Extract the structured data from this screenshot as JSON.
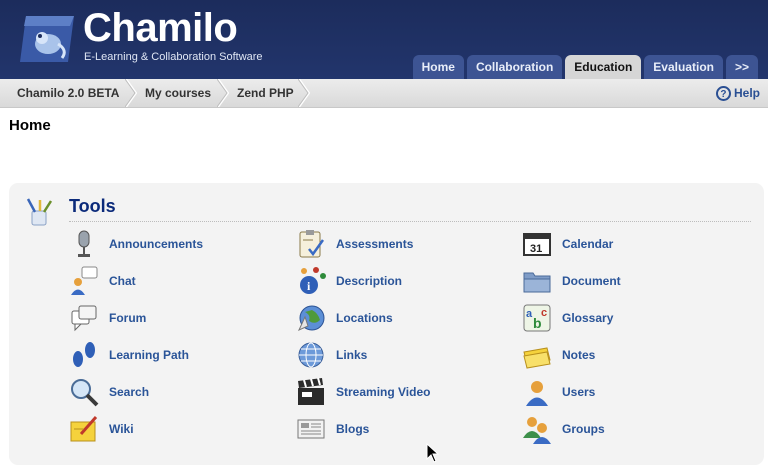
{
  "header": {
    "logo_title": "Chamilo",
    "logo_subtitle": "E-Learning & Collaboration Software",
    "tabs": [
      {
        "label": "Home"
      },
      {
        "label": "Collaboration"
      },
      {
        "label": "Education",
        "active": true
      },
      {
        "label": "Evaluation"
      },
      {
        "label": ">>"
      }
    ]
  },
  "breadcrumb": {
    "items": [
      {
        "label": "Chamilo 2.0 BETA"
      },
      {
        "label": "My courses"
      },
      {
        "label": "Zend PHP"
      }
    ],
    "help_label": "Help"
  },
  "page": {
    "title": "Home"
  },
  "tools": {
    "title": "Tools",
    "columns": [
      [
        {
          "label": "Announcements",
          "icon": "microphone-icon"
        },
        {
          "label": "Chat",
          "icon": "chat-icon"
        },
        {
          "label": "Forum",
          "icon": "forum-icon"
        },
        {
          "label": "Learning Path",
          "icon": "footprints-icon"
        },
        {
          "label": "Search",
          "icon": "magnifier-icon"
        },
        {
          "label": "Wiki",
          "icon": "wiki-icon"
        }
      ],
      [
        {
          "label": "Assessments",
          "icon": "clipboard-icon"
        },
        {
          "label": "Description",
          "icon": "info-icon"
        },
        {
          "label": "Locations",
          "icon": "globe-location-icon"
        },
        {
          "label": "Links",
          "icon": "globe-icon"
        },
        {
          "label": "Streaming Video",
          "icon": "clapperboard-icon"
        },
        {
          "label": "Blogs",
          "icon": "newspaper-icon"
        }
      ],
      [
        {
          "label": "Calendar",
          "icon": "calendar-icon"
        },
        {
          "label": "Document",
          "icon": "folder-icon"
        },
        {
          "label": "Glossary",
          "icon": "glossary-icon"
        },
        {
          "label": "Notes",
          "icon": "notes-icon"
        },
        {
          "label": "Users",
          "icon": "user-icon"
        },
        {
          "label": "Groups",
          "icon": "group-icon"
        }
      ]
    ],
    "calendar_day": "31",
    "glossary_letters": "abc"
  },
  "colors": {
    "header_bg": "#1c2c5c",
    "tab_bg": "#3d5493",
    "tab_active_bg": "#d6d6d6",
    "link": "#2a5498",
    "tools_title": "#0b2a7a"
  }
}
